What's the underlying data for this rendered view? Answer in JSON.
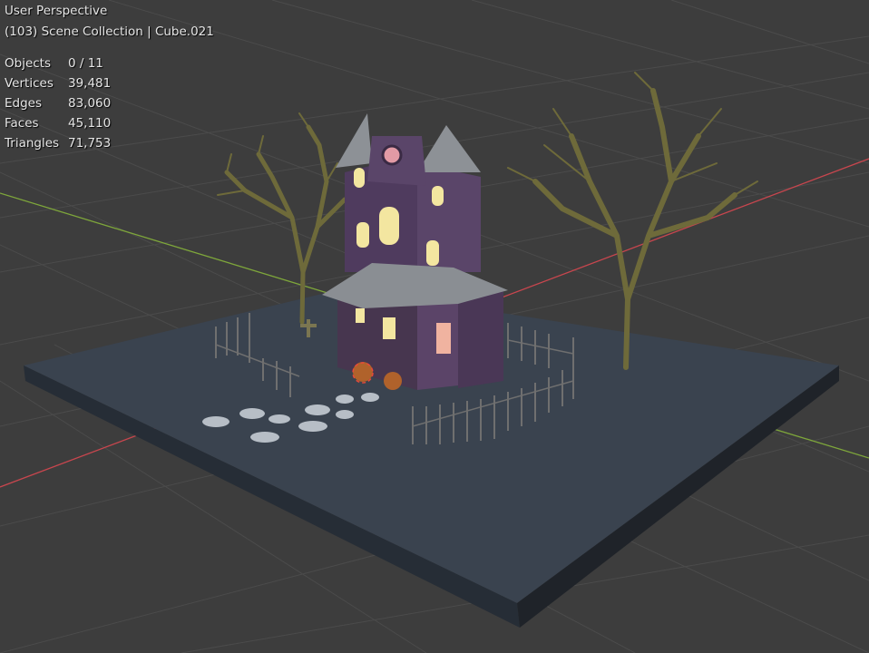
{
  "viewport": {
    "view_name": "User Perspective",
    "collection_line": "(103) Scene Collection | Cube.021"
  },
  "stats": [
    {
      "key": "objects",
      "label": "Objects",
      "value": "0 / 11"
    },
    {
      "key": "vertices",
      "label": "Vertices",
      "value": "39,481"
    },
    {
      "key": "edges",
      "label": "Edges",
      "value": "83,060"
    },
    {
      "key": "faces",
      "label": "Faces",
      "value": "45,110"
    },
    {
      "key": "triangles",
      "label": "Triangles",
      "value": "71,753"
    }
  ],
  "colors": {
    "background": "#3d3d3d",
    "grid": "#4a4a4a",
    "x_axis": "#c8464e",
    "y_axis": "#7ea63b",
    "ground_top": "#3a434f",
    "house_wall": "#4f3b5e",
    "roof": "#8d9196",
    "window_glow": "#f3e6a0"
  }
}
